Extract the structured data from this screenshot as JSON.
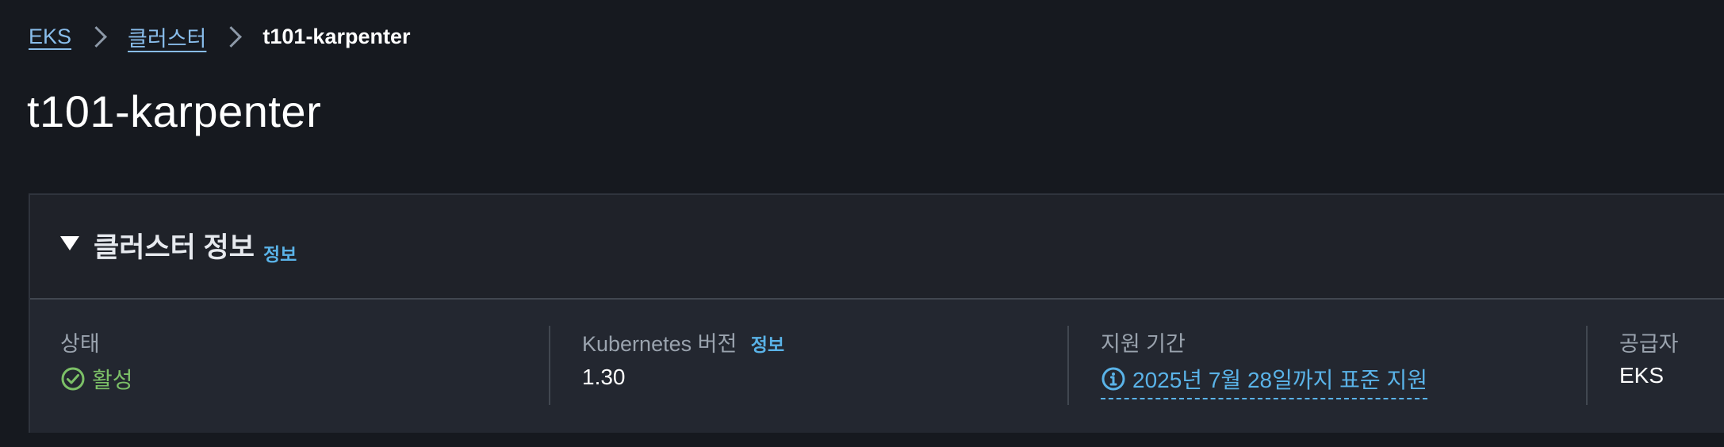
{
  "breadcrumb": {
    "items": [
      "EKS",
      "클러스터"
    ],
    "current": "t101-karpenter"
  },
  "page_title": "t101-karpenter",
  "section": {
    "title": "클러스터 정보",
    "info": "정보"
  },
  "details": {
    "status": {
      "label": "상태",
      "value": "활성",
      "icon": "check-circle-icon"
    },
    "k8s_version": {
      "label": "Kubernetes 버전",
      "info": "정보",
      "value": "1.30"
    },
    "support_period": {
      "label": "지원 기간",
      "value": "2025년 7월 28일까지 표준 지원",
      "icon": "info-circle-icon"
    },
    "provider": {
      "label": "공급자",
      "value": "EKS"
    }
  },
  "colors": {
    "background": "#16191f",
    "panel": "#232730",
    "link": "#5ab3e8",
    "success": "#7cc067"
  }
}
